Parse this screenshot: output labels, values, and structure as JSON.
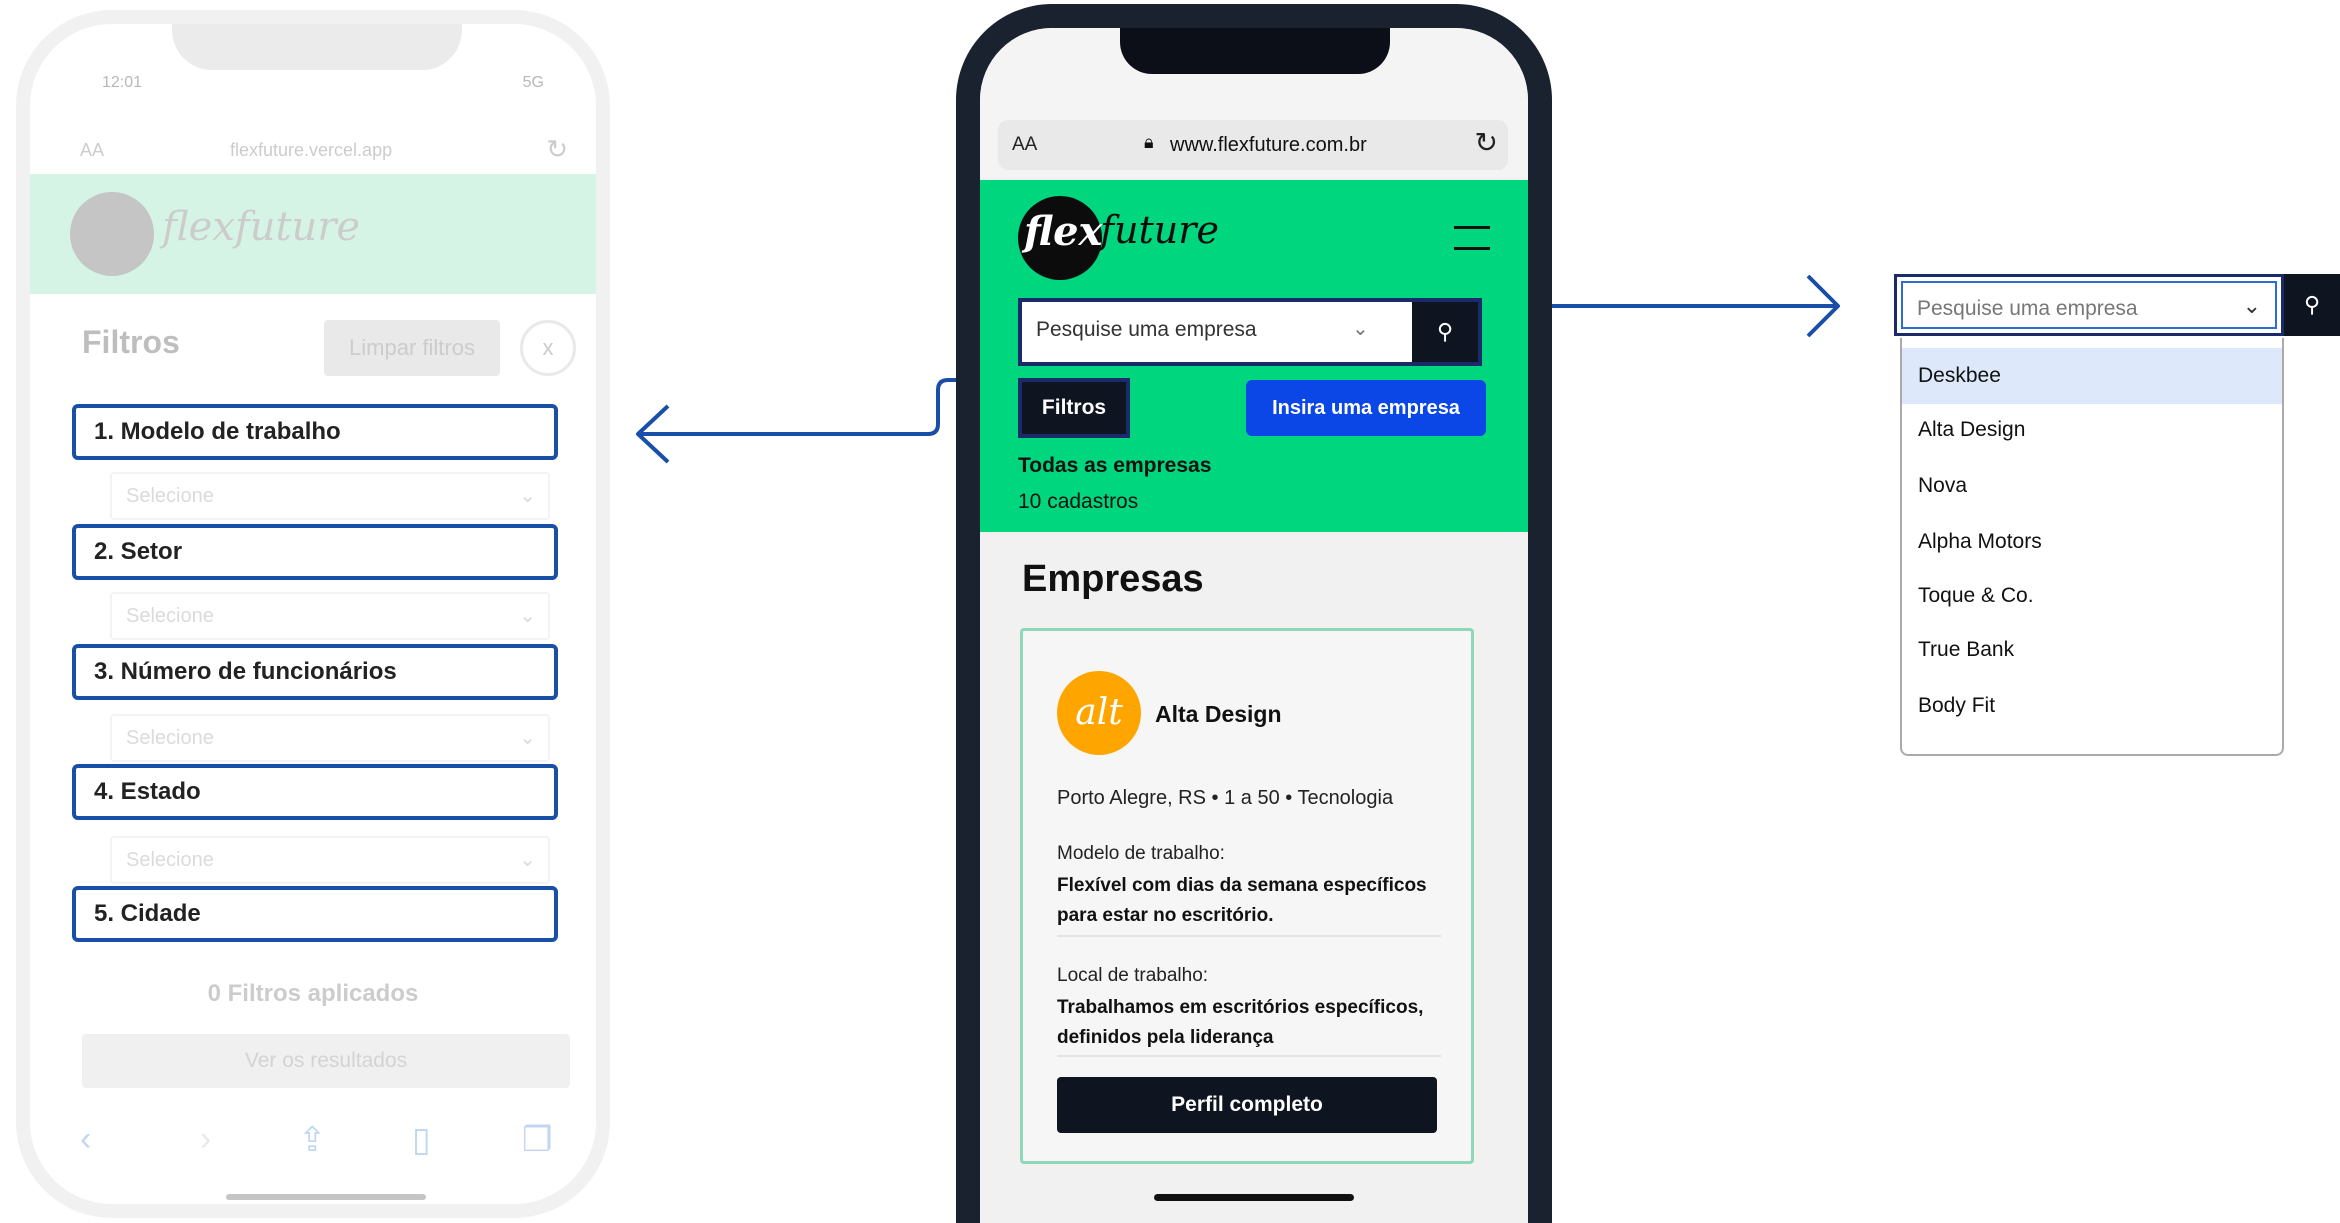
{
  "left_phone": {
    "status_time": "12:01",
    "status_signal": "5G",
    "url_aa": "AA",
    "url": "flexfuture.vercel.app",
    "logo_text": "flexfuture",
    "filters_title": "Filtros",
    "clear_filters_label": "Limpar filtros",
    "close_label": "x",
    "filters": [
      {
        "label": "1. Modelo de trabalho",
        "placeholder": "Selecione"
      },
      {
        "label": "2. Setor",
        "placeholder": "Selecione"
      },
      {
        "label": "3. Número de funcionários",
        "placeholder": "Selecione"
      },
      {
        "label": "4. Estado",
        "placeholder": "Selecione"
      },
      {
        "label": "5. Cidade"
      }
    ],
    "applied_text": "0 Filtros aplicados",
    "results_button": "Ver os resultados"
  },
  "center_phone": {
    "url_aa": "AA",
    "url": "www.flexfuture.com.br",
    "logo_flex": "flex",
    "logo_future": "future",
    "search_placeholder": "Pesquise uma empresa",
    "filtros_button": "Filtros",
    "insert_button": "Insira uma empresa",
    "all_companies_title": "Todas as empresas",
    "count_text": "10 cadastros",
    "section_title": "Empresas",
    "card": {
      "logo_text": "alt",
      "name": "Alta Design",
      "info": "Porto Alegre, RS • 1 a 50 • Tecnologia",
      "work_model_label": "Modelo de trabalho:",
      "work_model_value": "Flexível com dias da semana específicos para estar no escritório.",
      "work_place_label": "Local de trabalho:",
      "work_place_value": "Trabalhamos em escritórios específicos, definidos pela liderança",
      "profile_button": "Perfil completo"
    }
  },
  "dropdown": {
    "placeholder": "Pesquise uma empresa",
    "options": [
      "Deskbee",
      "Alta Design",
      "Nova",
      "Alpha Motors",
      "Toque & Co.",
      "True Bank",
      "Body Fit"
    ],
    "selected_index": 0
  },
  "colors": {
    "accent_green": "#00d67e",
    "primary_blue": "#0b46e6",
    "highlight_border": "#1a4fa8",
    "dark": "#0f1520"
  }
}
